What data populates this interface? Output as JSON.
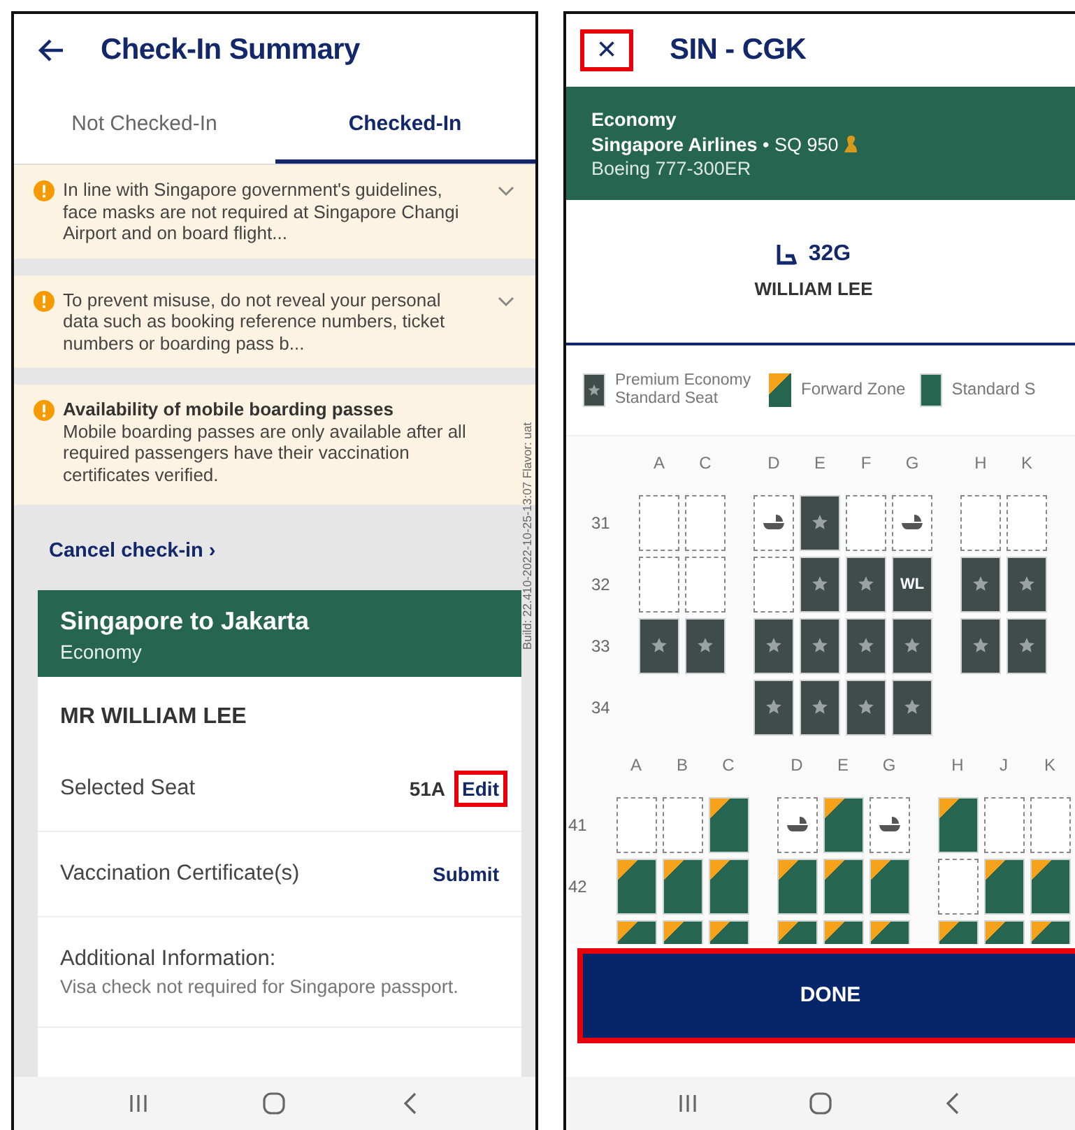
{
  "checkin": {
    "title": "Check-In Summary",
    "tabs": [
      {
        "label": "Not Checked-In",
        "selected": false
      },
      {
        "label": "Checked-In",
        "selected": true
      }
    ],
    "notices": [
      {
        "kind": "collapsible",
        "text": "In line with Singapore government's guidelines, face masks are not required at Singapore Changi Airport and on board flight...",
        "expanded": false
      },
      {
        "kind": "collapsible",
        "text": "To prevent misuse, do not reveal your personal data such as booking reference numbers, ticket numbers or boarding pass b...",
        "expanded": false
      },
      {
        "kind": "info",
        "title": "Availability of mobile boarding passes",
        "text": "Mobile boarding passes are only available after all required passengers have their vaccination certificates verified."
      }
    ],
    "build_info": "Build: 22.410-2022-10-25-13:07 Flavor: uat",
    "cancel_link": "Cancel check-in ›",
    "card": {
      "route": "Singapore to Jakarta",
      "cabin": "Economy",
      "passenger": "MR WILLIAM LEE",
      "details": [
        {
          "kind": "action",
          "label": "Selected Seat",
          "value": "51A",
          "action": "Edit",
          "highlighted": true
        },
        {
          "kind": "action",
          "label": "Vaccination Certificate(s)",
          "action": "Submit",
          "highlighted": false
        },
        {
          "kind": "info",
          "label": "Additional Information:",
          "text": "Visa check not required for Singapore passport."
        }
      ]
    }
  },
  "seatmap": {
    "title": "SIN - CGK",
    "close": {
      "label": "×",
      "highlighted": true
    },
    "flight": {
      "cabin": "Economy",
      "carrier": "**Singapore Airlines** • SQ 950",
      "aircraft": "Boeing 777-300ER"
    },
    "seat": "32G",
    "passenger": "WILLIAM LEE",
    "legend": [
      {
        "kind": "premium",
        "label": "Premium Economy Standard Seat"
      },
      {
        "kind": "forward",
        "label": "Forward Zone"
      },
      {
        "kind": "standard",
        "label": "Standard S"
      }
    ],
    "cabins": [
      {
        "columns": [
          [
            "A",
            "C"
          ],
          [
            "D",
            "E",
            "F",
            "G"
          ],
          [
            "H",
            "K"
          ]
        ],
        "rows": [
          {
            "row": "31",
            "seats": [
              [
                {
                  "kind": "empty"
                },
                {
                  "kind": "empty"
                }
              ],
              [
                {
                  "kind": "bassinet"
                },
                {
                  "kind": "premium"
                },
                {
                  "kind": "empty"
                },
                {
                  "kind": "bassinet"
                }
              ],
              [
                {
                  "kind": "empty"
                },
                {
                  "kind": "empty"
                }
              ]
            ]
          },
          {
            "row": "32",
            "seats": [
              [
                {
                  "kind": "empty"
                },
                {
                  "kind": "empty"
                }
              ],
              [
                {
                  "kind": "empty"
                },
                {
                  "kind": "premium"
                },
                {
                  "kind": "premium"
                },
                {
                  "kind": "waitlist",
                  "label": "WL"
                }
              ],
              [
                {
                  "kind": "premium"
                },
                {
                  "kind": "premium"
                }
              ]
            ]
          },
          {
            "row": "33",
            "seats": [
              [
                {
                  "kind": "premium"
                },
                {
                  "kind": "premium"
                }
              ],
              [
                {
                  "kind": "premium"
                },
                {
                  "kind": "premium"
                },
                {
                  "kind": "premium"
                },
                {
                  "kind": "premium"
                }
              ],
              [
                {
                  "kind": "premium"
                },
                {
                  "kind": "premium"
                }
              ]
            ]
          },
          {
            "row": "34",
            "seats": [
              [
                {
                  "kind": "blank"
                },
                {
                  "kind": "blank"
                }
              ],
              [
                {
                  "kind": "premium"
                },
                {
                  "kind": "premium"
                },
                {
                  "kind": "premium"
                },
                {
                  "kind": "premium"
                }
              ],
              [
                {
                  "kind": "blank"
                },
                {
                  "kind": "blank"
                }
              ]
            ]
          }
        ]
      },
      {
        "columns": [
          [
            "A",
            "B",
            "C"
          ],
          [
            "D",
            "E",
            "G"
          ],
          [
            "H",
            "J",
            "K"
          ]
        ],
        "rows": [
          {
            "row": "41",
            "seats": [
              [
                {
                  "kind": "empty"
                },
                {
                  "kind": "empty"
                },
                {
                  "kind": "forward"
                }
              ],
              [
                {
                  "kind": "bassinet"
                },
                {
                  "kind": "forward"
                },
                {
                  "kind": "bassinet"
                }
              ],
              [
                {
                  "kind": "forward"
                },
                {
                  "kind": "empty"
                },
                {
                  "kind": "empty"
                }
              ]
            ]
          },
          {
            "row": "42",
            "seats": [
              [
                {
                  "kind": "forward"
                },
                {
                  "kind": "forward"
                },
                {
                  "kind": "forward"
                }
              ],
              [
                {
                  "kind": "forward"
                },
                {
                  "kind": "forward"
                },
                {
                  "kind": "forward"
                }
              ],
              [
                {
                  "kind": "empty"
                },
                {
                  "kind": "forward"
                },
                {
                  "kind": "forward"
                }
              ]
            ]
          },
          {
            "seats": [
              [
                {
                  "kind": "forward"
                },
                {
                  "kind": "forward"
                },
                {
                  "kind": "forward"
                }
              ],
              [
                {
                  "kind": "forward"
                },
                {
                  "kind": "forward"
                },
                {
                  "kind": "forward"
                }
              ],
              [
                {
                  "kind": "forward"
                },
                {
                  "kind": "forward"
                },
                {
                  "kind": "forward"
                }
              ]
            ]
          }
        ]
      }
    ],
    "done": {
      "label": "DONE",
      "highlighted": true
    }
  }
}
